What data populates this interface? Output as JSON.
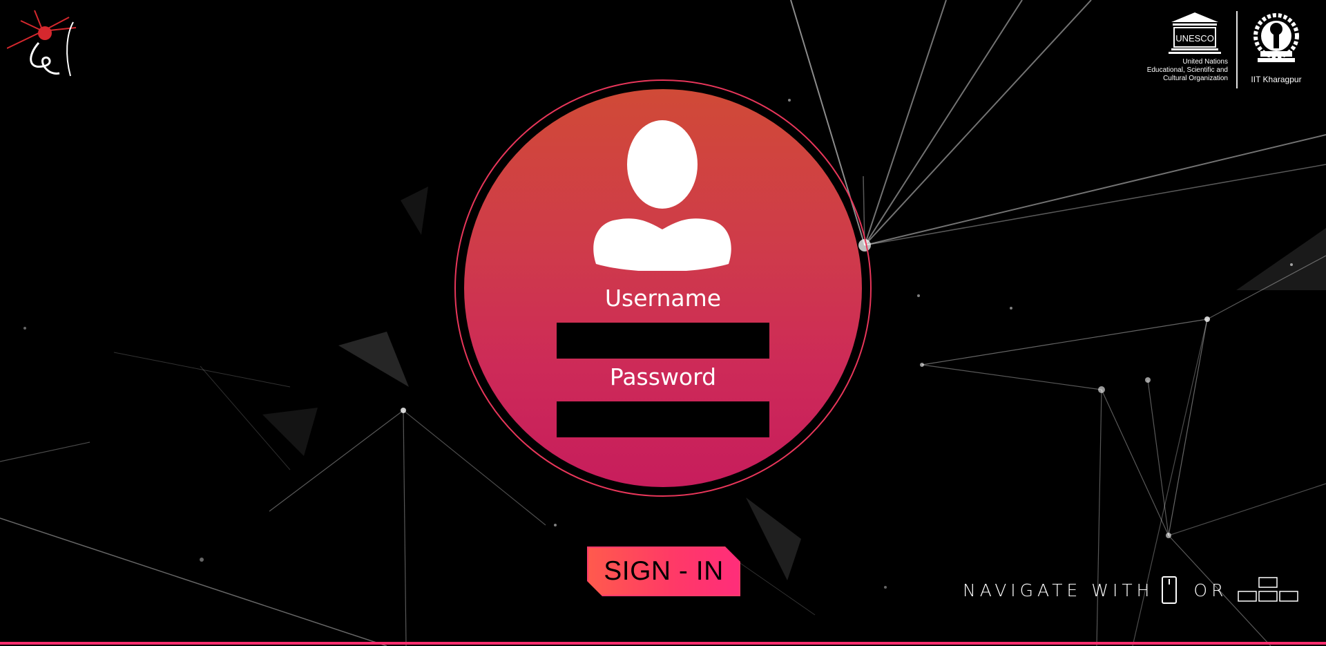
{
  "form": {
    "username_label": "Username",
    "username_value": "",
    "password_label": "Password",
    "password_value": ""
  },
  "signin": {
    "label": "SIGN - IN"
  },
  "nav_hint": {
    "prefix": "NAVIGATE WITH",
    "middle": "OR",
    "icons": [
      "mouse-icon",
      "arrow-keys-icon"
    ]
  },
  "logos": {
    "left": "event-logo",
    "unesco": {
      "wordmark": "UNESCO",
      "caption_lines": [
        "United Nations",
        "Educational, Scientific and",
        "Cultural Organization"
      ]
    },
    "iit": {
      "caption": "IIT Kharagpur"
    }
  },
  "colors": {
    "accent": "#ff2d6e",
    "circle_top": "#d04a37",
    "circle_bottom": "#c71d5c",
    "background": "#000000"
  }
}
